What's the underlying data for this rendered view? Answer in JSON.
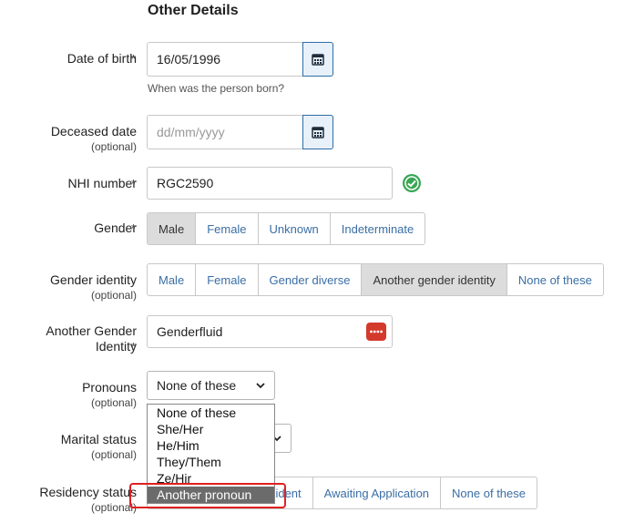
{
  "section_title": "Other Details",
  "dob": {
    "label": "Date of birth",
    "required": "*",
    "value": "16/05/1996",
    "hint": "When was the person born?"
  },
  "deceased": {
    "label": "Deceased date",
    "optional": "(optional)",
    "placeholder": "dd/mm/yyyy"
  },
  "nhi": {
    "label": "NHI number",
    "required": "*",
    "value": "RGC2590"
  },
  "gender": {
    "label": "Gender",
    "required": "*",
    "options": [
      "Male",
      "Female",
      "Unknown",
      "Indeterminate"
    ],
    "selected": "Male"
  },
  "gender_identity": {
    "label": "Gender identity",
    "optional": "(optional)",
    "options": [
      "Male",
      "Female",
      "Gender diverse",
      "Another gender identity",
      "None of these"
    ],
    "selected": "Another gender identity"
  },
  "another_gender": {
    "label_line1": "Another Gender",
    "label_line2": "Identity",
    "required": "*",
    "value": "Genderfluid"
  },
  "pronouns": {
    "label": "Pronouns",
    "optional": "(optional)",
    "value": "None of these",
    "options": [
      "None of these",
      "She/Her",
      "He/Him",
      "They/Them",
      "Ze/Hir",
      "Another pronoun"
    ],
    "highlighted": "Another pronoun"
  },
  "marital": {
    "label": "Marital status",
    "optional": "(optional)"
  },
  "residency": {
    "label": "Residency status",
    "optional": "(optional)",
    "options_visible": [
      "esident",
      "Awaiting Application",
      "None of these"
    ]
  },
  "colors": {
    "accent": "#3a6ea5",
    "valid": "#3aa655",
    "danger": "#d33a2c",
    "annotation": "#e02020"
  }
}
